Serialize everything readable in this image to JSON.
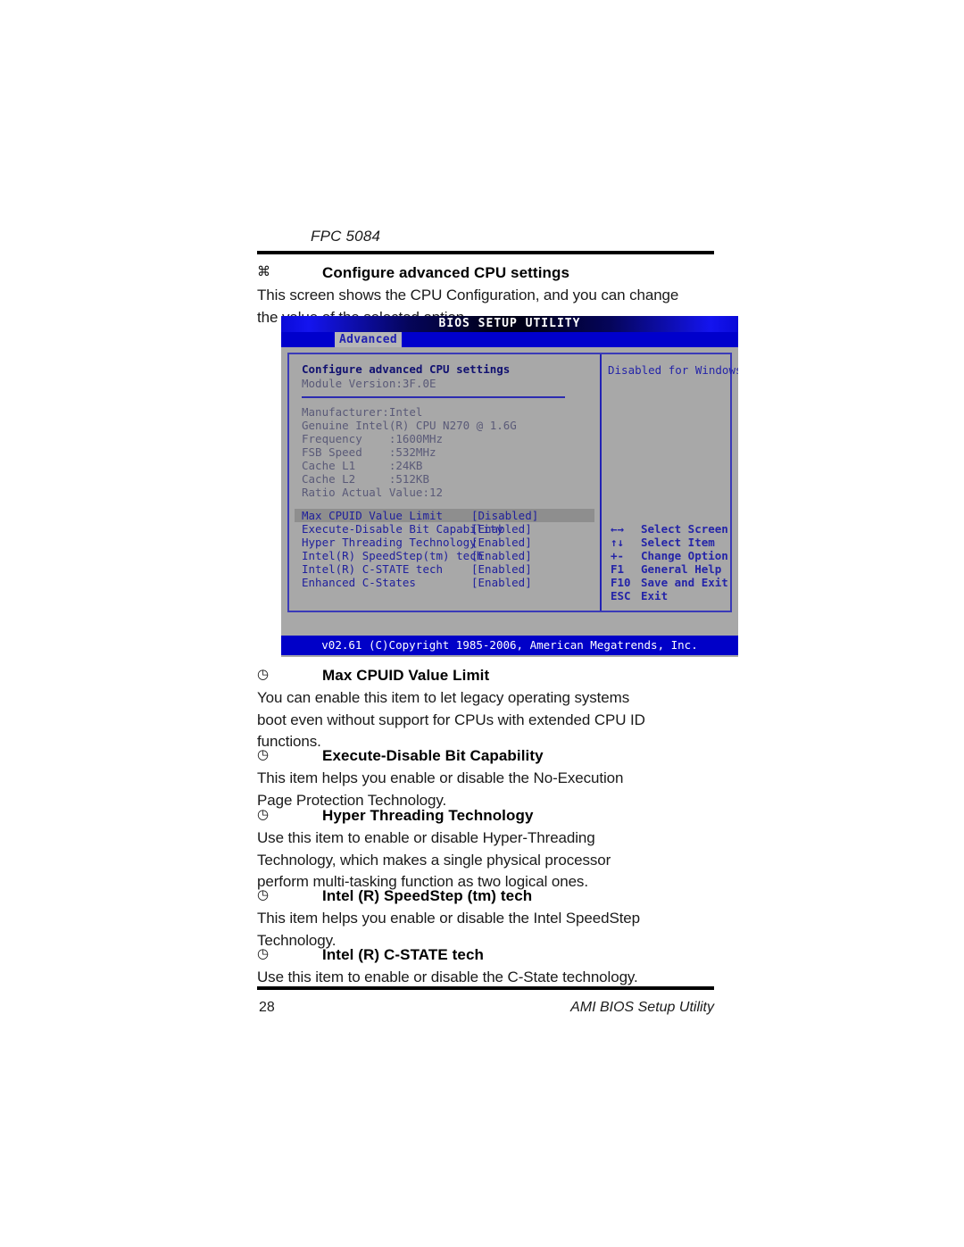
{
  "page": {
    "header_title": "FPC 5084",
    "footer_page_number": "28",
    "footer_label": "AMI BIOS Setup Utility"
  },
  "intro": {
    "bullet_glyph": "⌘",
    "heading": "Configure advanced CPU settings",
    "lines": [
      "This screen shows the CPU Configuration, and you can change",
      "the value of the selected option."
    ]
  },
  "bios": {
    "title": "BIOS SETUP UTILITY",
    "tab": "Advanced",
    "section_title": "Configure advanced CPU settings",
    "module_version": "Module Version:3F.0E",
    "info_lines": [
      "Manufacturer:Intel",
      "Genuine Intel(R) CPU N270 @ 1.6G",
      "Frequency    :1600MHz",
      "FSB Speed    :532MHz",
      "Cache L1     :24KB",
      "Cache L2     :512KB",
      "Ratio Actual Value:12"
    ],
    "settings": [
      {
        "label": "Max CPUID Value Limit",
        "value": "[Disabled]",
        "selected": true
      },
      {
        "label": "Execute-Disable Bit Capability",
        "value": "[Enabled]",
        "selected": false
      },
      {
        "label": "Hyper Threading Technology",
        "value": "[Enabled]",
        "selected": false
      },
      {
        "label": "Intel(R) SpeedStep(tm) tech",
        "value": "[Enabled]",
        "selected": false
      },
      {
        "label": "Intel(R) C-STATE tech",
        "value": "[Enabled]",
        "selected": false
      },
      {
        "label": "Enhanced C-States",
        "value": "[Enabled]",
        "selected": false
      }
    ],
    "help_text": "Disabled for WindowsXP",
    "keys": [
      {
        "key": "←→",
        "desc": "Select Screen"
      },
      {
        "key": "↑↓",
        "desc": "Select Item"
      },
      {
        "key": "+-",
        "desc": "Change Option"
      },
      {
        "key": "F1",
        "desc": "General Help"
      },
      {
        "key": "F10",
        "desc": "Save and Exit"
      },
      {
        "key": "ESC",
        "desc": "Exit"
      }
    ],
    "copyright": "v02.61 (C)Copyright 1985-2006, American Megatrends, Inc."
  },
  "descriptions": [
    {
      "glyph": "◷",
      "heading": "Max CPUID Value Limit",
      "lines": [
        "You can enable this item to let legacy operating systems",
        "boot even without support for CPUs with extended CPU ID",
        "functions."
      ]
    },
    {
      "glyph": "◷",
      "heading": "Execute-Disable Bit Capability",
      "lines": [
        "This item helps you enable or disable the No-Execution",
        "Page Protection Technology."
      ]
    },
    {
      "glyph": "◷",
      "heading": "Hyper Threading Technology",
      "lines": [
        "Use this item to enable or disable Hyper-Threading",
        "Technology, which makes a single physical processor",
        "perform multi-tasking function as two logical ones."
      ]
    },
    {
      "glyph": "◷",
      "heading": "Intel (R) SpeedStep (tm) tech",
      "lines": [
        "This item helps you enable or disable the Intel SpeedStep",
        "Technology."
      ]
    },
    {
      "glyph": "◷",
      "heading": "Intel (R) C-STATE tech",
      "lines": [
        "Use this item to enable or disable the C-State technology."
      ]
    }
  ]
}
